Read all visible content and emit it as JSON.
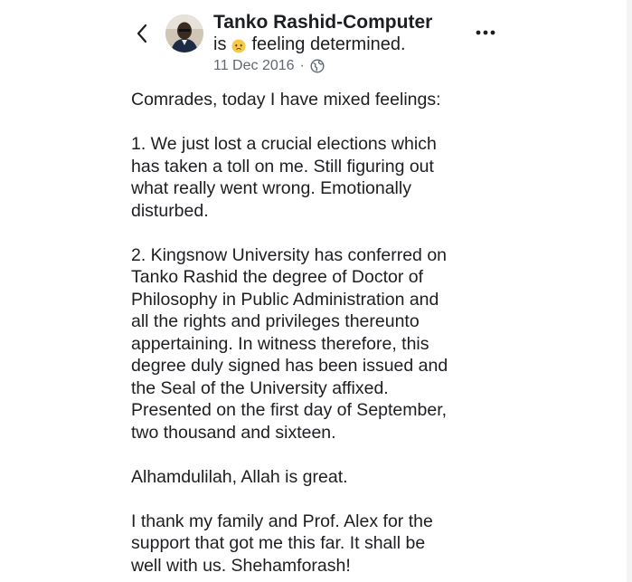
{
  "header": {
    "author_name": "Tanko Rashid-Computer",
    "status_prefix": "is",
    "feeling_text": "feeling determined.",
    "timestamp": "11 Dec 2016",
    "separator": "·",
    "privacy_icon": "globe-icon",
    "back_icon": "chevron-left-icon",
    "more_icon": "more-horizontal-icon",
    "feeling_emoji_icon": "determined-face-emoji"
  },
  "post": {
    "paragraphs": [
      [
        "Comrades, today I have mixed feelings:"
      ],
      [
        "1. We just lost a crucial elections which",
        "has taken a toll on me.  Still figuring out",
        "what really went wrong. Emotionally",
        "disturbed."
      ],
      [
        "2. Kingsnow University has conferred on",
        "Tanko Rashid the degree of Doctor of",
        "Philosophy in Public Administration and",
        "all the rights and privileges thereunto",
        "appertaining. In witness therefore, this",
        "degree duly signed has been issued and",
        "the Seal of the University affixed.",
        "Presented on the first day of September,",
        "two thousand and sixteen."
      ],
      [
        "Alhamdulilah, Allah is great."
      ],
      [
        "I thank my family and Prof. Alex for the",
        "support that got me this far. It shall be",
        "well with us. Shehamforash!"
      ]
    ]
  },
  "colors": {
    "text": "#1c1e21",
    "meta": "#606770",
    "emoji": "#f7c948"
  }
}
